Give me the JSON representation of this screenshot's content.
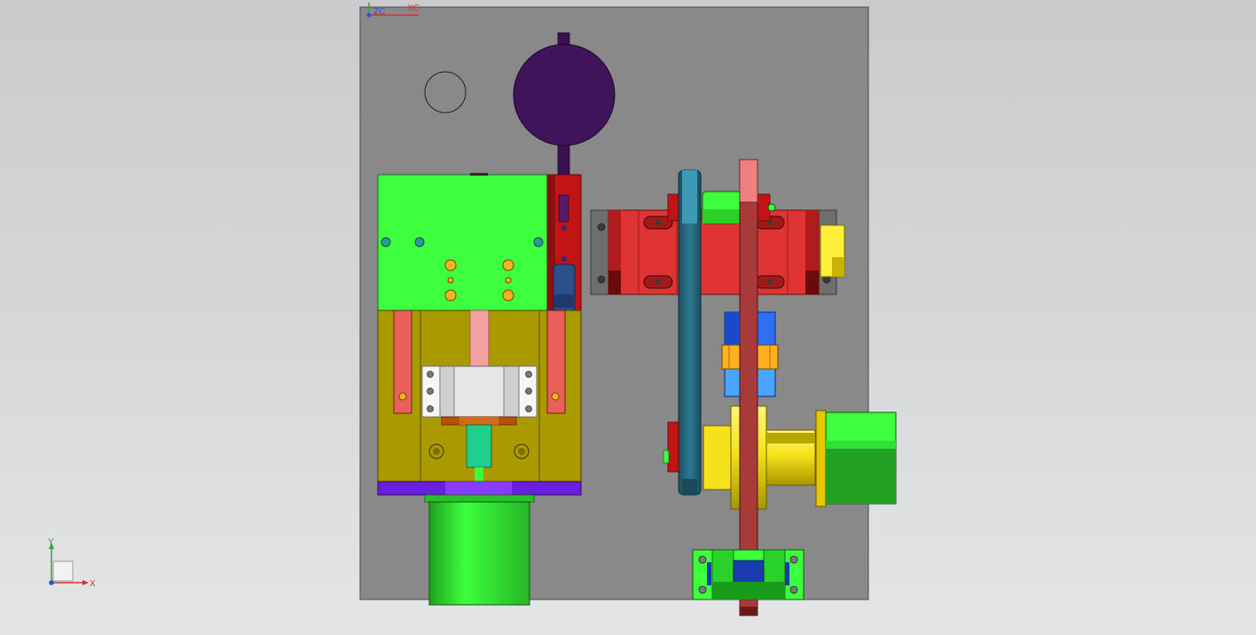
{
  "viewport": {
    "wcs_labels": {
      "zc": "ZC",
      "xc": "XC"
    },
    "triad": {
      "y": "Y",
      "x": "X"
    }
  },
  "colors": {
    "plate": "#898989",
    "plate_edge": "#4a4a4a",
    "bright_green": "#3dff3d",
    "dark_green": "#22a022",
    "olive": "#aa9a00",
    "purple": "#40145a",
    "violet": "#6a1ee0",
    "red": "#e03434",
    "dark_red": "#8c1a1a",
    "teal": "#2c6f86",
    "salmon": "#e86058",
    "pink": "#f2a0a0",
    "yellow": "#ffef3a",
    "gold": "#e7c800",
    "orange": "#ffb020",
    "blue": "#2f6ff5",
    "silver": "#e6e6e6"
  },
  "icons": [
    "wcs-icon",
    "coordinate-triad-icon"
  ]
}
